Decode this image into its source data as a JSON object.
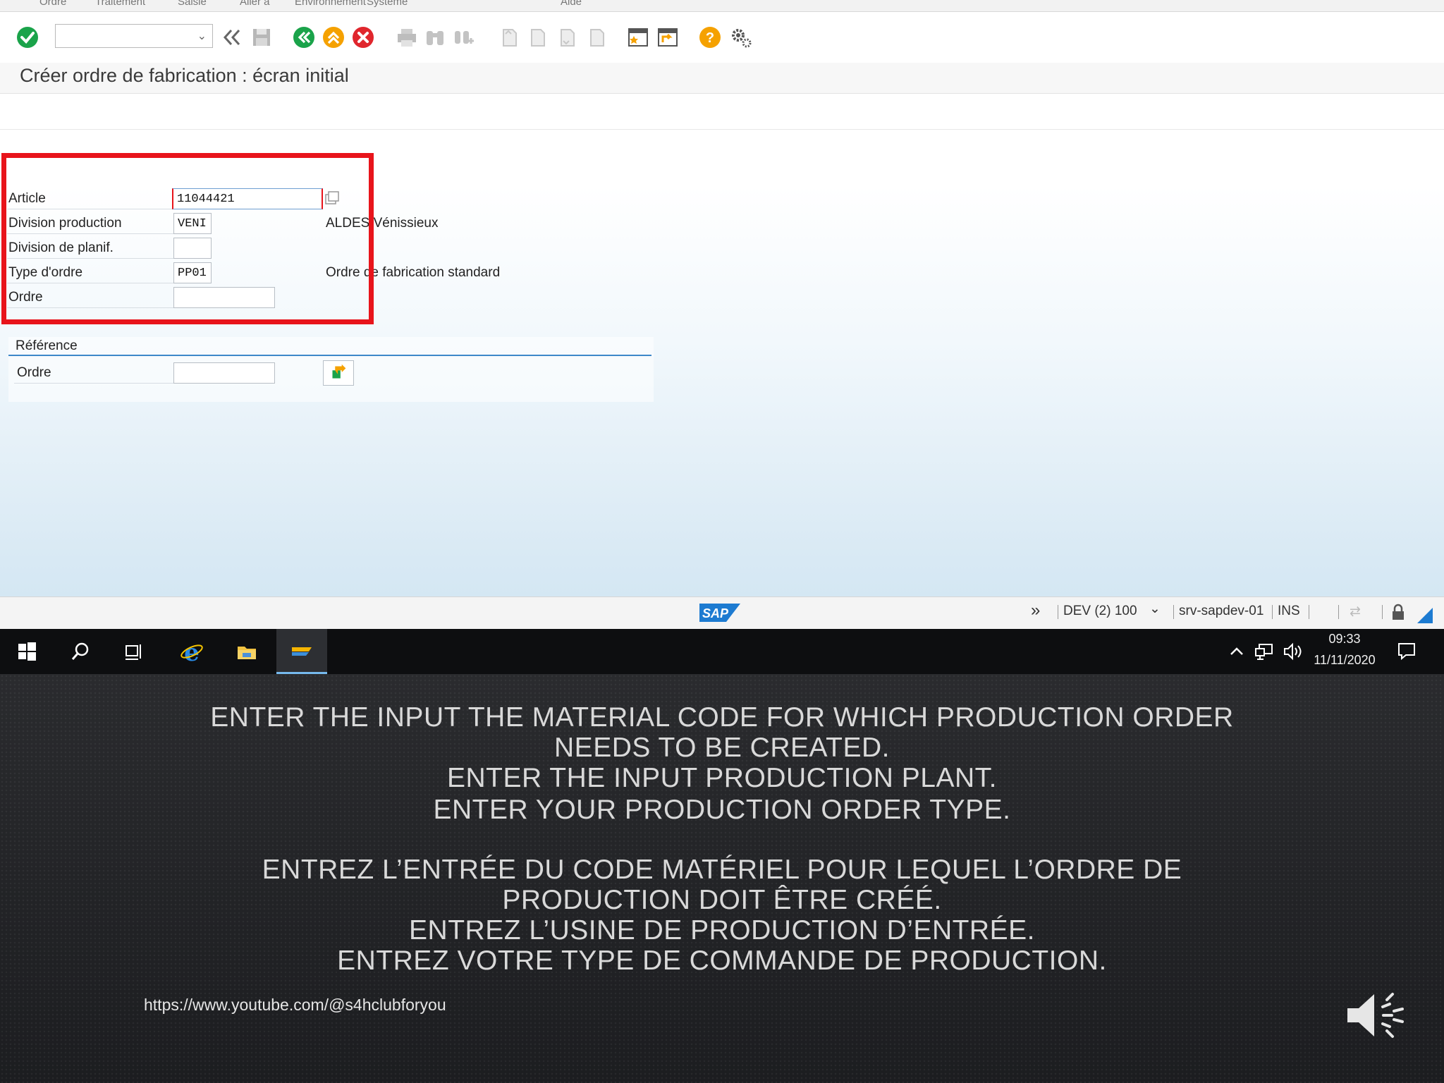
{
  "menu": [
    "Ordre",
    "Traitement",
    "Saisie",
    "Aller à",
    "Environnement",
    "Système",
    "Aide"
  ],
  "toolbar": {
    "icons": [
      "enter-icon",
      "back-icon",
      "exit-icon",
      "cancel-icon",
      "print-icon",
      "find-icon",
      "help-icon",
      "settings-icon"
    ]
  },
  "page": {
    "title": "Créer ordre de fabrication : écran initial"
  },
  "form": {
    "article_label": "Article",
    "article_value": "11044421",
    "division_prod_label": "Division production",
    "division_prod_value": "VENI",
    "division_prod_desc": "ALDES Vénissieux",
    "division_planif_label": "Division de planif.",
    "division_planif_value": "",
    "type_ordre_label": "Type d'ordre",
    "type_ordre_value": "PP01",
    "type_ordre_desc": "Ordre de fabrication standard",
    "ordre_label": "Ordre",
    "ordre_value": ""
  },
  "reference": {
    "title": "Référence",
    "ordre_label": "Ordre",
    "ordre_value": ""
  },
  "status": {
    "logo": "SAP",
    "system": "DEV (2) 100",
    "server": "srv-sapdev-01",
    "mode": "INS"
  },
  "taskbar": {
    "time": "09:33",
    "date": "11/11/2020"
  },
  "slide": {
    "en_lines": [
      "ENTER THE INPUT THE MATERIAL CODE FOR WHICH PRODUCTION ORDER",
      "NEEDS TO BE CREATED.",
      "ENTER THE INPUT PRODUCTION PLANT.",
      "ENTER YOUR PRODUCTION ORDER TYPE."
    ],
    "fr_lines": [
      "ENTREZ L’ENTRÉE DU CODE MATÉRIEL POUR LEQUEL L’ORDRE DE",
      "PRODUCTION DOIT ÊTRE CRÉÉ.",
      "ENTREZ L’USINE DE PRODUCTION D’ENTRÉE.",
      "ENTREZ VOTRE TYPE DE COMMANDE DE PRODUCTION."
    ],
    "url": "https://www.youtube.com/@s4hclubforyou"
  },
  "colors": {
    "highlight": "#e8141b",
    "accent_line": "#3d88c9",
    "ok_green": "#1aa34a",
    "orange": "#f5a100",
    "red": "#e0262d"
  }
}
